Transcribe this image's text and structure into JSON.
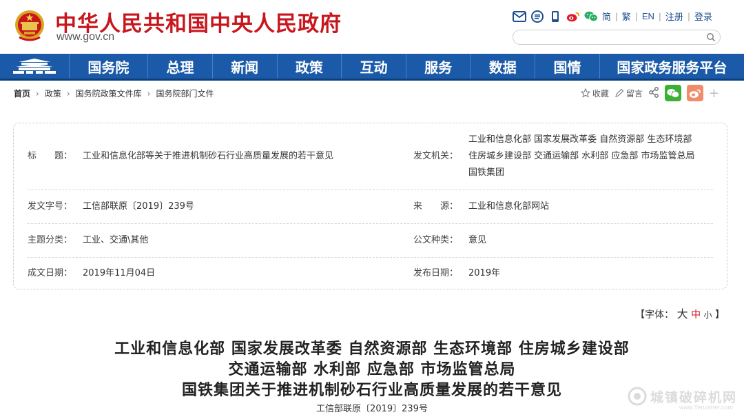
{
  "header": {
    "site_title": "中华人民共和国中央人民政府",
    "site_url": "www.gov.cn",
    "links": [
      "简",
      "繁",
      "EN",
      "注册",
      "登录"
    ],
    "icons": [
      "mail-icon",
      "rss-icon",
      "mobile-icon",
      "weibo-icon",
      "wechat-icon"
    ],
    "search_placeholder": ""
  },
  "nav": {
    "items": [
      "国务院",
      "总理",
      "新闻",
      "政策",
      "互动",
      "服务",
      "数据",
      "国情",
      "国家政务服务平台"
    ]
  },
  "breadcrumb": [
    "首页",
    "政策",
    "国务院政策文件库",
    "国务院部门文件"
  ],
  "tools": {
    "favorite": "收藏",
    "message": "留言"
  },
  "info": {
    "title_label": "标　　题：",
    "title_value": "工业和信息化部等关于推进机制砂石行业高质量发展的若干意见",
    "issuer_label": "发文机关：",
    "issuer_lines": [
      "工业和信息化部 国家发展改革委 自然资源部 生态环境部",
      "住房城乡建设部 交通运输部 水利部 应急部 市场监管总局",
      "国铁集团"
    ],
    "docno_label": "发文字号：",
    "docno_value": "工信部联原〔2019〕239号",
    "source_label": "来　　源：",
    "source_value": "工业和信息化部网站",
    "topic_label": "主题分类：",
    "topic_value": "工业、交通\\其他",
    "doctype_label": "公文种类：",
    "doctype_value": "意见",
    "written_label": "成文日期：",
    "written_value": "2019年11月04日",
    "published_label": "发布日期：",
    "published_value": "2019年"
  },
  "font_size": {
    "prefix": "【字体：",
    "large": "大",
    "medium": "中",
    "small": "小",
    "suffix": "】"
  },
  "article": {
    "title_lines": [
      "工业和信息化部 国家发展改革委 自然资源部 生态环境部 住房城乡建设部",
      "交通运输部 水利部 应急部 市场监管总局",
      "国铁集团关于推进机制砂石行业高质量发展的若干意见"
    ],
    "doc_number": "工信部联原〔2019〕239号"
  },
  "watermark": {
    "text": "城镇破碎机网",
    "url": "www.Yeruisher.com"
  },
  "colors": {
    "brand_red": "#c8161d",
    "nav_blue": "#1b5aa8",
    "link_blue": "#1f4e8e"
  }
}
